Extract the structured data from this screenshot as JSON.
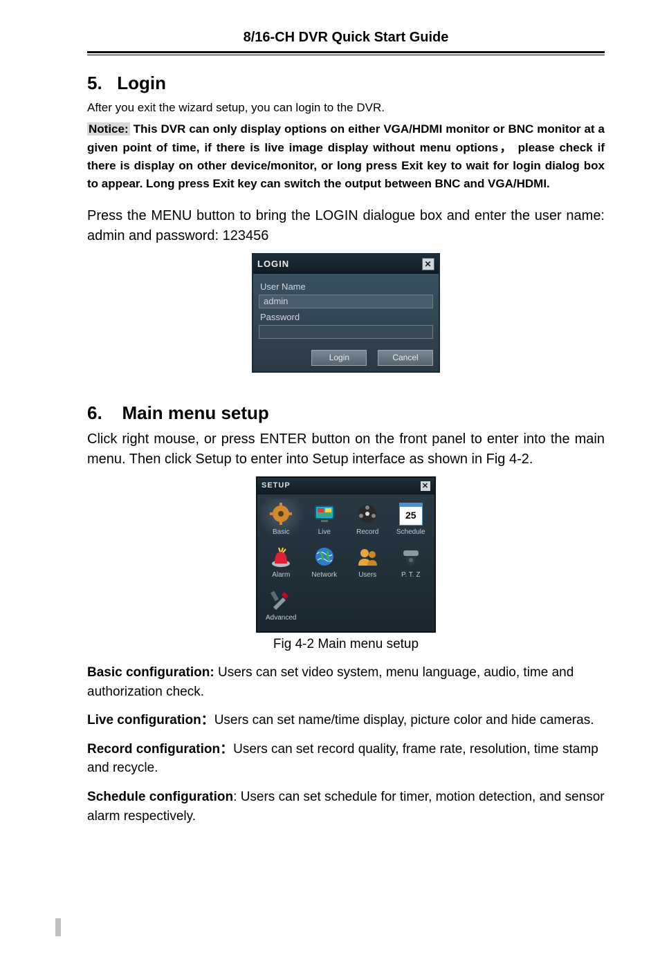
{
  "header": {
    "title": "8/16-CH DVR Quick Start Guide"
  },
  "section5": {
    "num": "5.",
    "title": "Login",
    "intro": "After you exit the wizard setup, you can login to the DVR.",
    "notice_label": "Notice:",
    "notice_text": " This DVR can only display options on either VGA/HDMI monitor or BNC monitor at a given point of time, if there is live image display without menu options， please check if there is display on other device/monitor, or long press Exit key to wait for login dialog box to appear. Long press Exit key can switch the output between BNC and VGA/HDMI.",
    "press_text": "Press the MENU button to bring the LOGIN dialogue box and enter the user name: admin and password: 123456"
  },
  "login_dialog": {
    "title": "LOGIN",
    "close": "✕",
    "user_label": "User Name",
    "user_value": "admin",
    "pass_label": "Password",
    "pass_value": "",
    "login_btn": "Login",
    "cancel_btn": "Cancel"
  },
  "section6": {
    "num": "6.",
    "title": "Main menu setup",
    "intro": "Click right mouse, or press ENTER button on the front panel to enter into the main menu. Then click Setup to enter into Setup interface as shown in Fig 4-2.",
    "fig_caption": "Fig 4-2 Main menu setup"
  },
  "setup_panel": {
    "title": "SETUP",
    "close": "✕",
    "items": [
      {
        "label": "Basic"
      },
      {
        "label": "Live"
      },
      {
        "label": "Record"
      },
      {
        "label": "Schedule",
        "cal": "25"
      },
      {
        "label": "Alarm"
      },
      {
        "label": "Network"
      },
      {
        "label": "Users"
      },
      {
        "label": "P. T. Z"
      },
      {
        "label": "Advanced"
      }
    ]
  },
  "configs": {
    "basic": {
      "lead": "Basic configuration:",
      "text": " Users can set video system, menu language, audio, time and authorization check."
    },
    "live": {
      "lead": "Live configuration：",
      "text": "Users can set name/time display, picture color and hide cameras."
    },
    "record": {
      "lead": "Record configuration：",
      "text": "Users can set record quality, frame rate, resolution, time stamp and recycle."
    },
    "schedule": {
      "lead": "Schedule configuration",
      "colon": ": ",
      "text": "Users can set schedule for timer, motion detection, and sensor alarm respectively."
    }
  }
}
